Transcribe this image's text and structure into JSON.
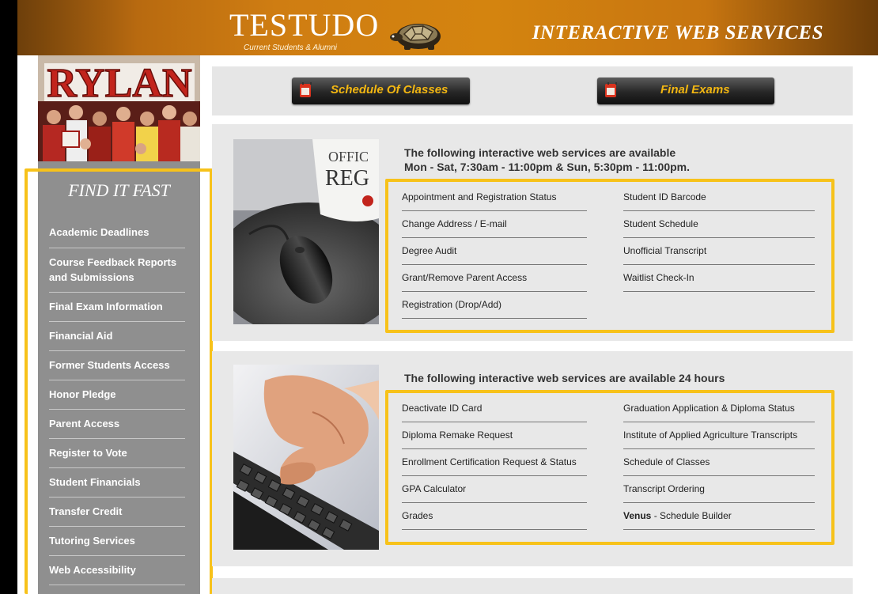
{
  "header": {
    "logo": "TESTUDO",
    "logo_subtitle": "Current Students & Alumni",
    "banner_title": "INTERACTIVE WEB SERVICES",
    "turtle_icon": "turtle-logo-icon",
    "accent_color": "#d4840f"
  },
  "sidebar": {
    "banner_text": "RYLAN",
    "title": "FIND IT FAST",
    "items": [
      {
        "label": "Academic Deadlines"
      },
      {
        "label": "Course Feedback Reports and Submissions"
      },
      {
        "label": "Final Exam Information"
      },
      {
        "label": "Financial Aid"
      },
      {
        "label": "Former Students Access"
      },
      {
        "label": "Honor Pledge"
      },
      {
        "label": "Parent Access"
      },
      {
        "label": "Register to Vote"
      },
      {
        "label": "Student Financials"
      },
      {
        "label": "Transfer Credit"
      },
      {
        "label": "Tutoring Services"
      },
      {
        "label": "Web Accessibility"
      }
    ]
  },
  "topbar": {
    "schedule_button": "Schedule Of Classes",
    "exams_button": "Final Exams",
    "button_icon": "calendar-icon",
    "button_text_color": "#f3b712"
  },
  "panel1": {
    "heading_line1": "The following interactive web services are available",
    "heading_line2": "Mon - Sat, 7:30am - 11:00pm & Sun, 5:30pm - 11:00pm.",
    "mug_text1": "OFFIC",
    "mug_text2": "REG",
    "left_links": [
      "Appointment and Registration Status",
      "Change Address / E-mail",
      "Degree Audit",
      "Grant/Remove Parent Access",
      "Registration (Drop/Add)"
    ],
    "right_links": [
      "Student ID Barcode",
      "Student Schedule",
      "Unofficial Transcript",
      "Waitlist Check-In"
    ]
  },
  "panel2": {
    "heading": "The following interactive web services are available 24 hours",
    "left_links": [
      "Deactivate ID Card",
      "Diploma Remake Request",
      "Enrollment Certification Request & Status",
      "GPA Calculator",
      "Grades"
    ],
    "right_links": [
      "Graduation Application & Diploma Status",
      "Institute of Applied Agriculture Transcripts",
      "Schedule of Classes",
      "Transcript Ordering"
    ],
    "venus_bold": "Venus",
    "venus_rest": " - Schedule Builder"
  },
  "highlight_color": "#f7c21a"
}
